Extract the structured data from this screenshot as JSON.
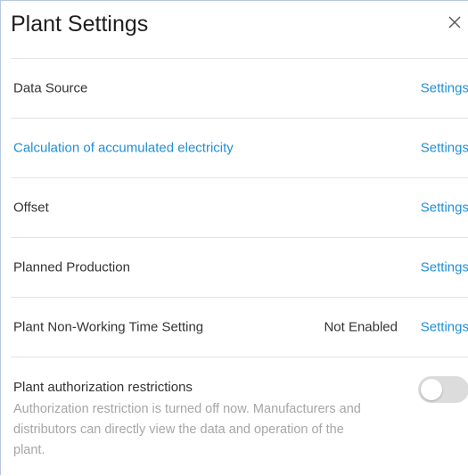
{
  "header": {
    "title": "Plant Settings",
    "close_icon": "close-icon"
  },
  "rows": [
    {
      "label": "Data Source",
      "action": "Settings",
      "label_is_link": false
    },
    {
      "label": "Calculation of accumulated electricity",
      "action": "Settings",
      "label_is_link": true
    },
    {
      "label": "Offset",
      "action": "Settings",
      "label_is_link": false
    },
    {
      "label": "Planned Production",
      "action": "Settings",
      "label_is_link": false
    },
    {
      "label": "Plant Non-Working Time Setting",
      "status": "Not Enabled",
      "action": "Settings",
      "label_is_link": false
    }
  ],
  "authorization": {
    "title": "Plant authorization restrictions",
    "description": "Authorization restriction is turned off now. Manufacturers and distributors can directly view the data and operation of the plant.",
    "toggle_on": false
  },
  "colors": {
    "accent": "#1f8fd6",
    "text": "#333333",
    "muted_text": "#a6a6a6",
    "divider": "#e3e3e3",
    "toggle_off": "#dcdcdc"
  }
}
